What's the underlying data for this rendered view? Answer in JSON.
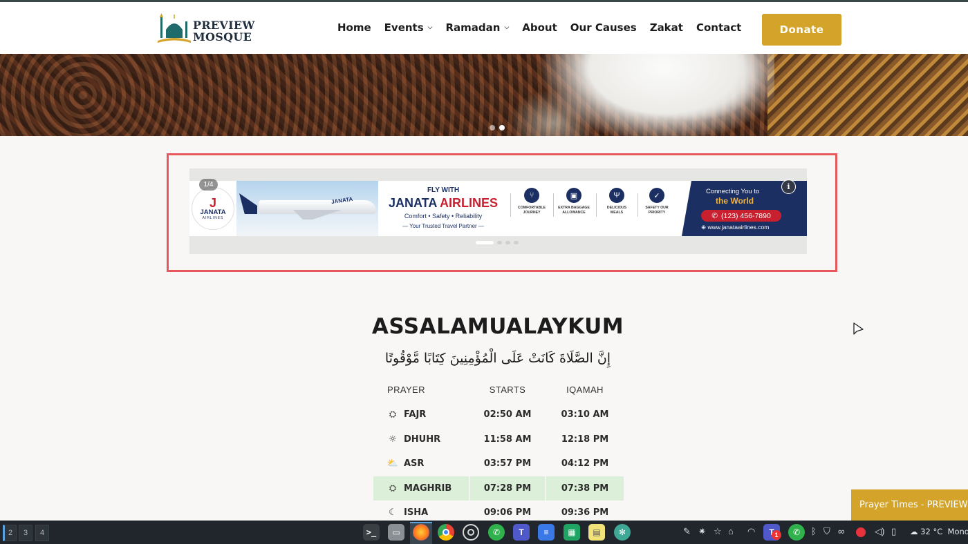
{
  "site": {
    "logo_line1": "PREVIEW",
    "logo_line2": "MOSQUE",
    "nav": [
      {
        "label": "Home",
        "dropdown": false
      },
      {
        "label": "Events",
        "dropdown": true
      },
      {
        "label": "Ramadan",
        "dropdown": true
      },
      {
        "label": "About",
        "dropdown": false
      },
      {
        "label": "Our Causes",
        "dropdown": false
      },
      {
        "label": "Zakat",
        "dropdown": false
      },
      {
        "label": "Contact",
        "dropdown": false
      }
    ],
    "donate_label": "Donate",
    "accent": "#d4a32a"
  },
  "hero": {
    "slides": 2,
    "active_slide": 2
  },
  "ad": {
    "counter": "1/4",
    "brand_short": "JANATA",
    "brand_sub": "AIRLINES",
    "plane_text": "JANATA",
    "fly_with": "FLY WITH",
    "headline_blue": "JANATA",
    "headline_red": "AIRLINES",
    "tagline": "Comfort • Safety • Reliability",
    "partner": "Your Trusted Travel Partner",
    "features": [
      {
        "icon": "seat-icon",
        "glyph": "⑂",
        "label_1": "COMFORTABLE",
        "label_2": "JOURNEY"
      },
      {
        "icon": "luggage-icon",
        "glyph": "▣",
        "label_1": "EXTRA BAGGAGE",
        "label_2": "ALLOWANCE"
      },
      {
        "icon": "cutlery-icon",
        "glyph": "Ψ",
        "label_1": "DELICIOUS",
        "label_2": "MEALS"
      },
      {
        "icon": "shield-icon",
        "glyph": "✓",
        "label_1": "SAFETY OUR",
        "label_2": "PRIORITY"
      }
    ],
    "connecting": "Connecting You to",
    "world": "the World",
    "phone": "(123) 456-7890",
    "website": "www.janataairlines.com",
    "slides": 4,
    "active_slide": 1,
    "frame_color": "#e8575c"
  },
  "greeting": "ASSALAMUALAYKUM",
  "verse": "إِنَّ الصَّلَاةَ كَانَتْ عَلَى الْمُؤْمِنِينَ كِتَابًا مَّوْقُوتًا",
  "prayer_table": {
    "headers": [
      "PRAYER",
      "STARTS",
      "IQAMAH"
    ],
    "rows": [
      {
        "name": "FAJR",
        "icon": "sunrise-icon",
        "starts": "02:50 AM",
        "iqamah": "03:10 AM",
        "highlight": false
      },
      {
        "name": "DHUHR",
        "icon": "sun-icon",
        "starts": "11:58 AM",
        "iqamah": "12:18 PM",
        "highlight": false
      },
      {
        "name": "ASR",
        "icon": "sun-cloud-icon",
        "starts": "03:57 PM",
        "iqamah": "04:12 PM",
        "highlight": false
      },
      {
        "name": "MAGHRIB",
        "icon": "sunset-icon",
        "starts": "07:28 PM",
        "iqamah": "07:38 PM",
        "highlight": true
      },
      {
        "name": "ISHA",
        "icon": "moon-icon",
        "starts": "09:06 PM",
        "iqamah": "09:36 PM",
        "highlight": false
      }
    ]
  },
  "prayer_tab": "Prayer Times - PREVIEW",
  "taskbar": {
    "workspaces": [
      "2",
      "3",
      "4"
    ],
    "weather": "32 °C",
    "day": "Mond",
    "badge": "1"
  }
}
